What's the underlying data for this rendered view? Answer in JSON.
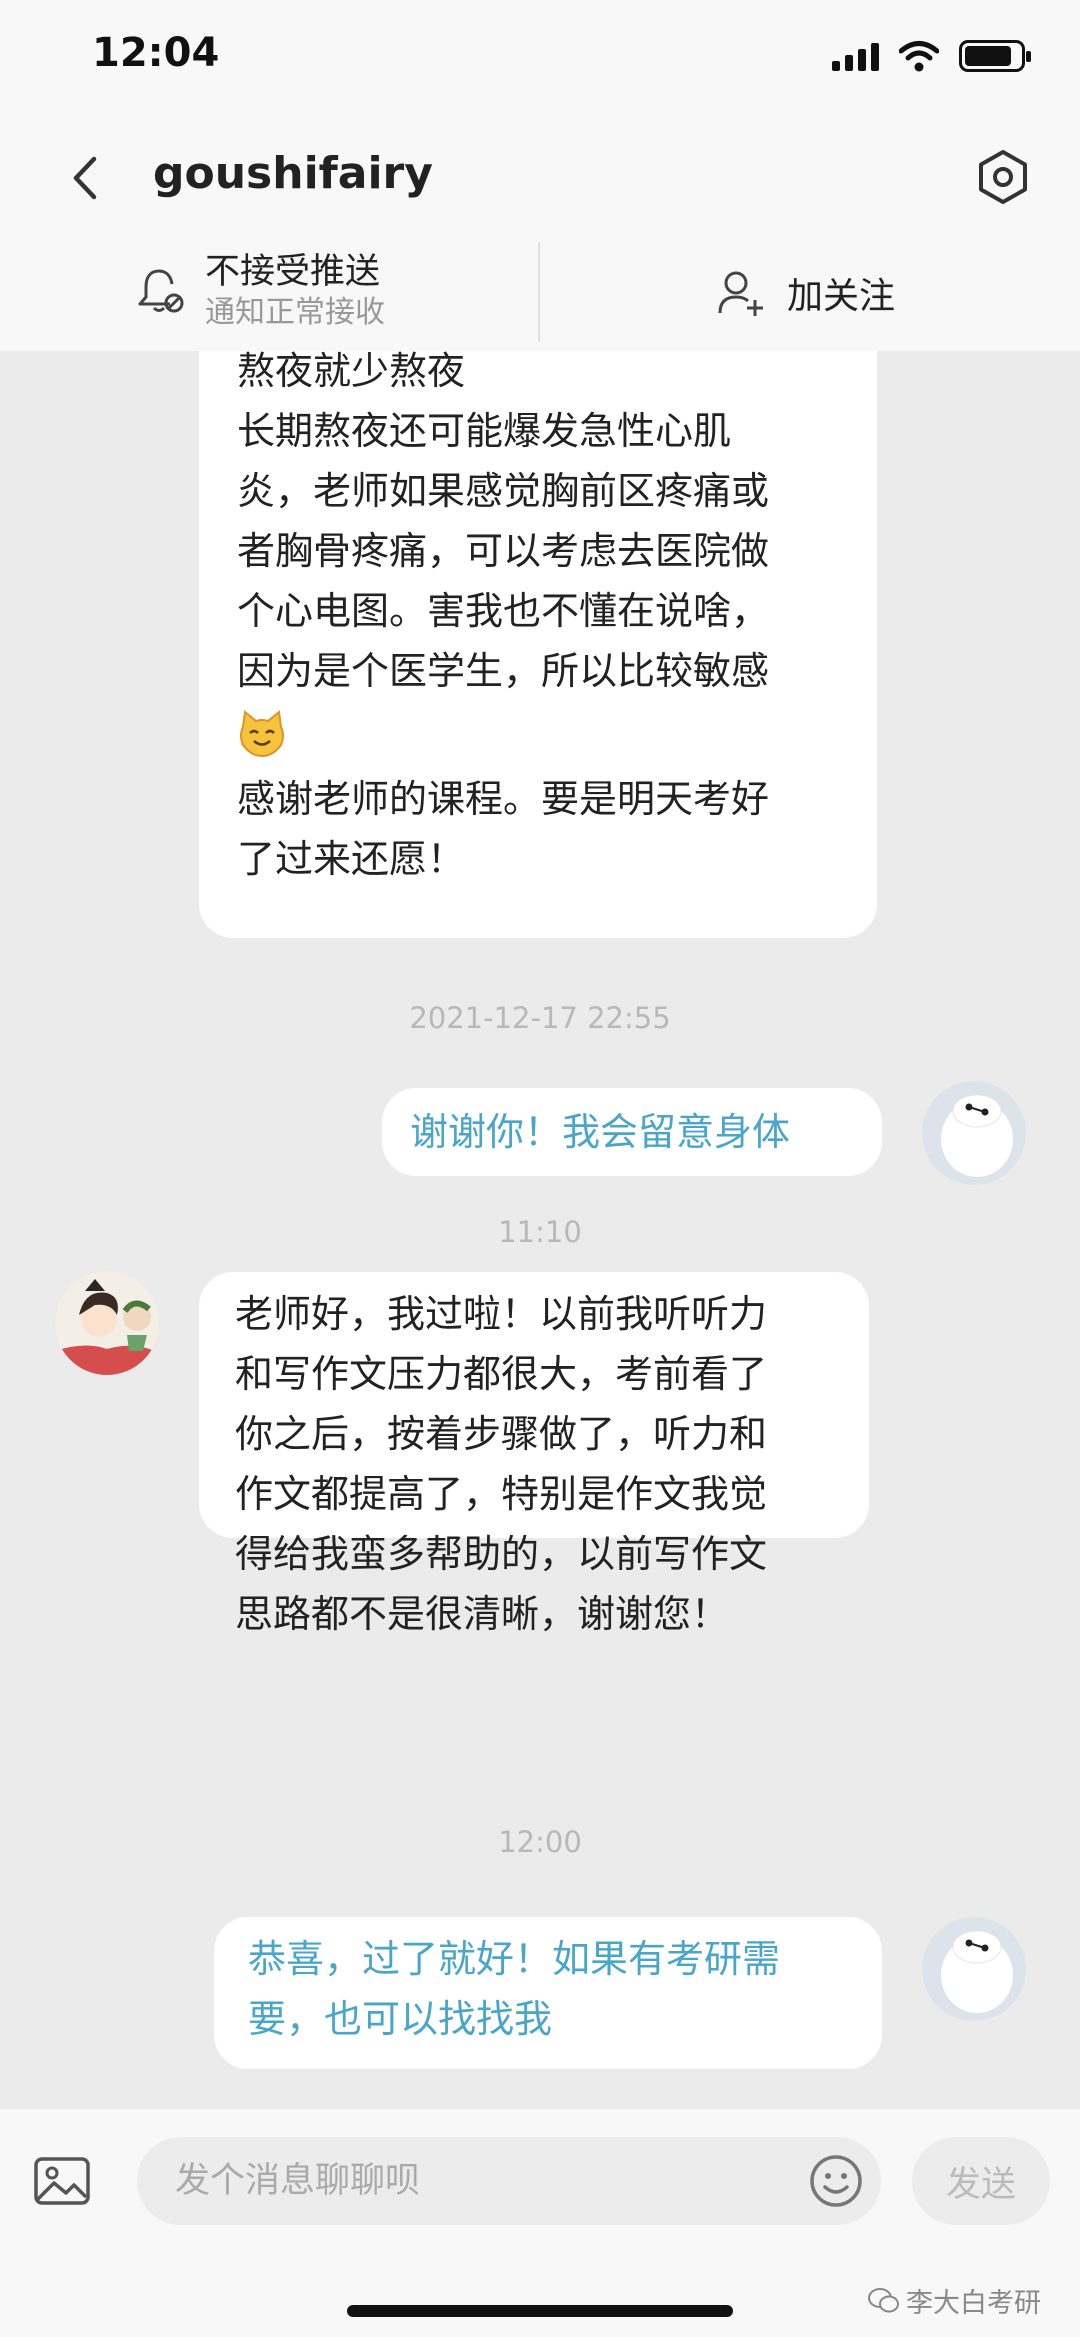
{
  "status": {
    "time": "12:04"
  },
  "nav": {
    "title": "goushifairy"
  },
  "notice": {
    "push_label": "不接受推送",
    "push_sub": "通知正常接收",
    "follow_label": "加关注"
  },
  "messages": [
    {
      "side": "received",
      "lines": [
        "熬夜就少熬夜",
        "长期熬夜还可能爆发急性心肌",
        "炎，老师如果感觉胸前区疼痛或",
        "者胸骨疼痛，可以考虑去医院做",
        "个心电图。害我也不懂在说啥，",
        "因为是个医学生，所以比较敏感",
        "",
        "感谢老师的课程。要是明天考好",
        "了过来还愿！"
      ]
    },
    {
      "timestamp": "2021-12-17 22:55"
    },
    {
      "side": "sent",
      "lines": [
        "谢谢你！我会留意身体"
      ]
    },
    {
      "timestamp": "11:10"
    },
    {
      "side": "received",
      "lines": [
        "老师好，我过啦！以前我听听力",
        "和写作文压力都很大，考前看了",
        "你之后，按着步骤做了，听力和",
        "作文都提高了，特别是作文我觉",
        "得给我蛮多帮助的，以前写作文",
        "思路都不是很清晰，谢谢您！"
      ]
    },
    {
      "timestamp": "12:00"
    },
    {
      "side": "sent",
      "lines": [
        "恭喜，过了就好！如果有考研需",
        "要，也可以找找我"
      ]
    }
  ],
  "input": {
    "placeholder": "发个消息聊聊呗",
    "send_label": "发送"
  },
  "watermark": "李大白考研",
  "colors": {
    "sent_text": "#4aa6c8",
    "background": "#ebebeb",
    "bubble": "#ffffff"
  }
}
